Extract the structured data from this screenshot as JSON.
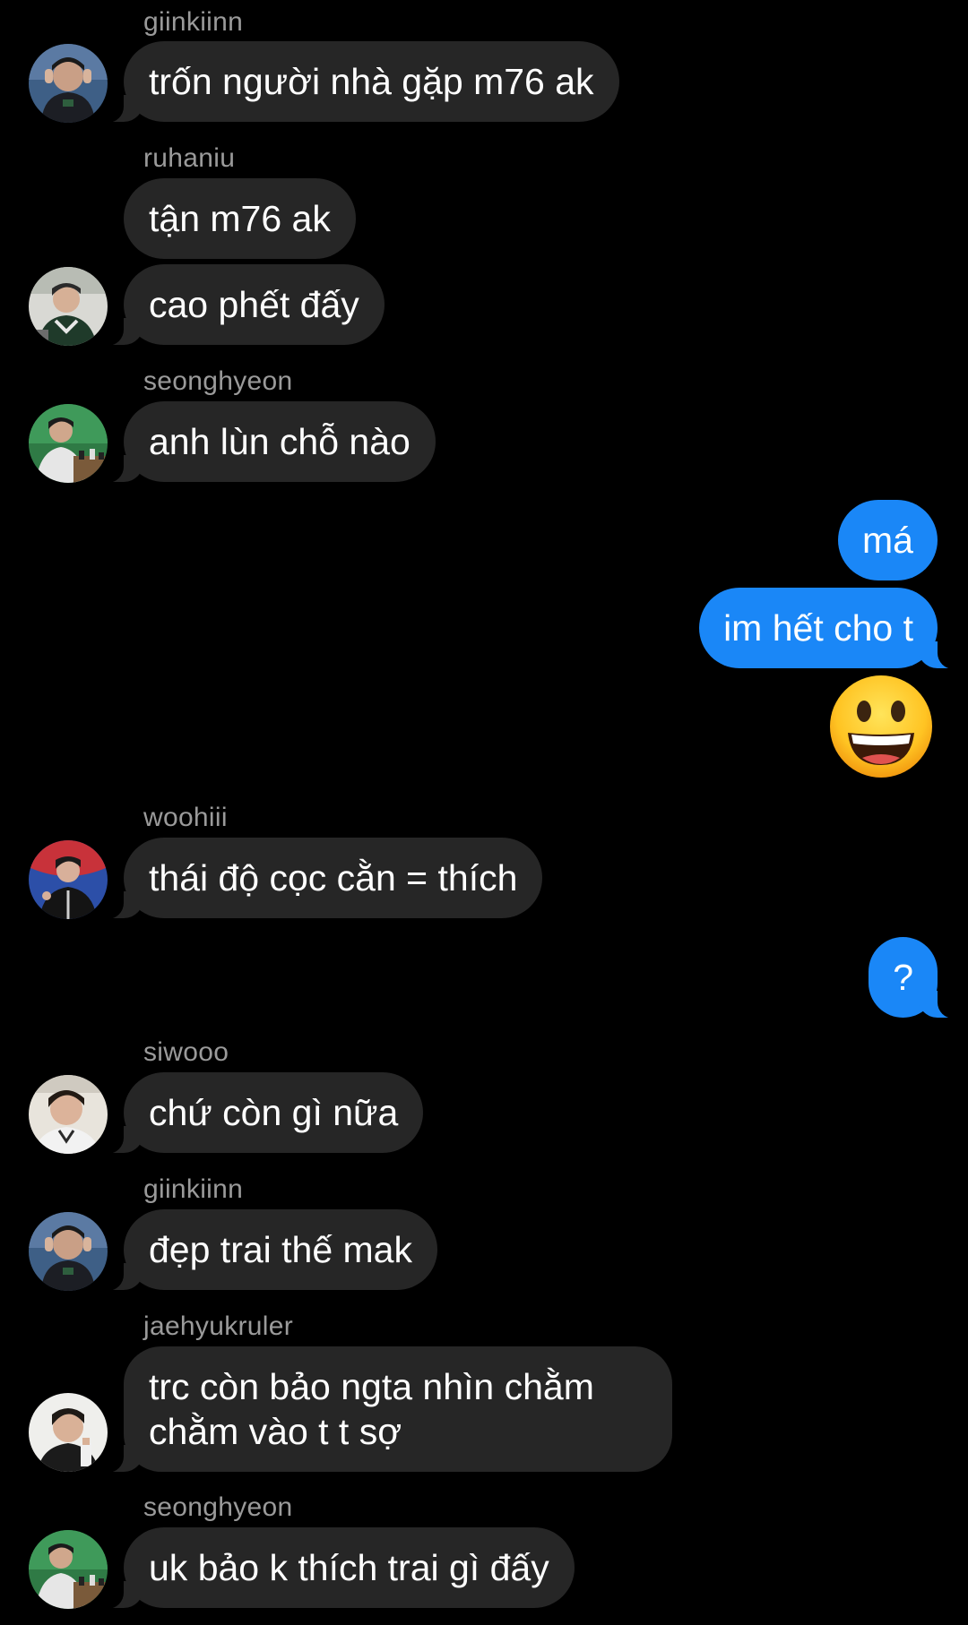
{
  "messages": [
    {
      "sender": "giinkiinn",
      "text": "trốn người nhà gặp m76 ak",
      "avatar": "avatar-giinkiinn"
    },
    {
      "sender": "ruhaniu",
      "texts": [
        "tận m76 ak",
        "cao phết đấy"
      ],
      "avatar": "avatar-ruhaniu"
    },
    {
      "sender": "seonghyeon",
      "text": "anh lùn chỗ nào",
      "avatar": "avatar-seonghyeon"
    },
    {
      "sender": "me",
      "texts": [
        "má",
        "im hết cho t"
      ],
      "emoji": "grinning-face-emoji"
    },
    {
      "sender": "woohiii",
      "text": "thái độ cọc cằn = thích",
      "avatar": "avatar-woohiii"
    },
    {
      "sender": "me",
      "text": "?"
    },
    {
      "sender": "siwooo",
      "text": "chứ còn gì nữa",
      "avatar": "avatar-siwooo"
    },
    {
      "sender": "giinkiinn",
      "text": "đẹp trai thế mak",
      "avatar": "avatar-giinkiinn"
    },
    {
      "sender": "jaehyukruler",
      "text": "trc còn bảo ngta nhìn chằm chằm vào t t sợ",
      "avatar": "avatar-jaehyukruler"
    },
    {
      "sender": "seonghyeon",
      "text": "uk bảo k thích trai gì đấy",
      "avatar": "avatar-seonghyeon"
    }
  ],
  "colors": {
    "background": "#000000",
    "incoming_bubble": "#262626",
    "outgoing_bubble": "#1a87f7",
    "username": "#9a9a9a",
    "text": "#ffffff"
  }
}
